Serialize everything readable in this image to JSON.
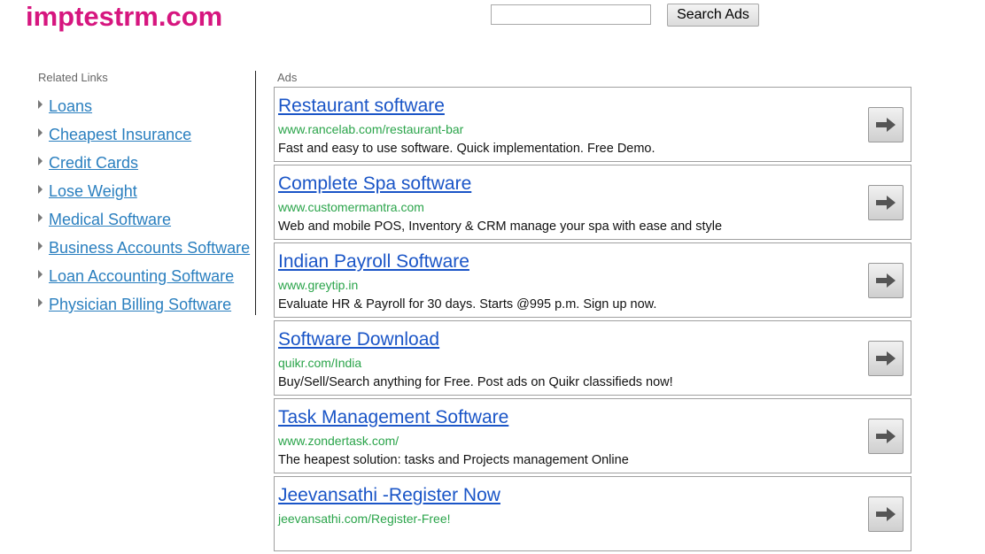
{
  "site": {
    "logo": "imptestrm.com"
  },
  "search": {
    "value": "",
    "button_label": "Search Ads"
  },
  "related": {
    "title": "Related Links",
    "items": [
      {
        "label": "Loans"
      },
      {
        "label": "Cheapest Insurance"
      },
      {
        "label": "Credit Cards"
      },
      {
        "label": "Lose Weight"
      },
      {
        "label": "Medical Software"
      },
      {
        "label": "Business Accounts Software"
      },
      {
        "label": "Loan Accounting Software"
      },
      {
        "label": "Physician Billing Software"
      }
    ]
  },
  "ads": {
    "title": "Ads",
    "items": [
      {
        "title": "Restaurant software",
        "url": "www.rancelab.com/restaurant-bar",
        "desc": "Fast and easy to use software. Quick implementation. Free Demo."
      },
      {
        "title": "Complete Spa software",
        "url": "www.customermantra.com",
        "desc": "Web and mobile POS, Inventory & CRM manage your spa with ease and style"
      },
      {
        "title": "Indian Payroll Software",
        "url": "www.greytip.in",
        "desc": "Evaluate HR & Payroll for 30 days. Starts @995 p.m. Sign up now."
      },
      {
        "title": "Software Download",
        "url": "quikr.com/India",
        "desc": "Buy/Sell/Search anything for Free. Post ads on Quikr classifieds now!"
      },
      {
        "title": "Task Management Software",
        "url": "www.zondertask.com/",
        "desc": "The heapest solution: tasks and Projects management Online"
      },
      {
        "title": "Jeevansathi -Register Now",
        "url": "jeevansathi.com/Register-Free!",
        "desc": ""
      }
    ]
  },
  "colors": {
    "logo": "#d6167f",
    "related_link": "#2a7fbf",
    "ad_title": "#1a55c7",
    "ad_url": "#2aa44a"
  },
  "icons": {
    "ad_arrow": "right-arrow-icon",
    "list_bullet": "triangle-bullet-icon"
  }
}
